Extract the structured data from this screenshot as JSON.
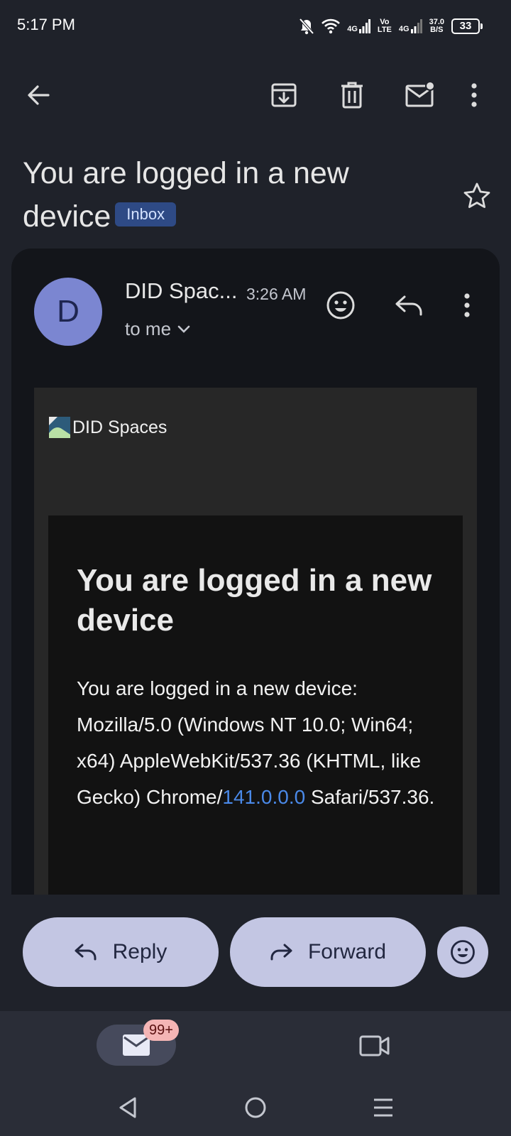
{
  "status_bar": {
    "time": "5:17 PM",
    "network_1": "4G",
    "volte_top": "Vo",
    "volte_bottom": "LTE",
    "network_2": "4G",
    "speed_value": "37.0",
    "speed_unit": "B/S",
    "battery": "33"
  },
  "toolbar": {
    "icons": [
      "back-arrow-icon",
      "archive-icon",
      "delete-icon",
      "mark-unread-icon",
      "more-vert-icon"
    ]
  },
  "subject": {
    "text": "You are logged in a new device",
    "label": "Inbox"
  },
  "message": {
    "avatar_letter": "D",
    "sender": "DID Spac...",
    "time": "3:26 AM",
    "recipient": "to me"
  },
  "email_body": {
    "logo_alt": "DID Spaces",
    "heading": "You are logged in a new device",
    "text_before_link": "You are logged in a new device: Mozilla/5.0 (Windows NT 10.0; Win64; x64) AppleWebKit/537.36 (KHTML, like Gecko) Chrome/",
    "link_text": "141.0.0.0",
    "text_after_link": " Safari/537.36."
  },
  "actions": {
    "reply_label": "Reply",
    "forward_label": "Forward"
  },
  "bottom_nav": {
    "mail_badge": "99+"
  },
  "colors": {
    "background": "#1f222a",
    "accent_button": "#c3c6e3",
    "inbox_chip": "#2e4a85",
    "avatar": "#7b86d1",
    "link": "#4a89e8"
  }
}
